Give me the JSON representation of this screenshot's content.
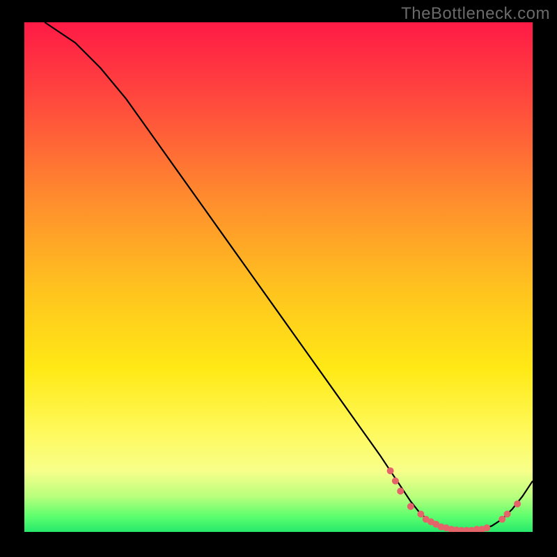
{
  "watermark": "TheBottleneck.com",
  "chart_data": {
    "type": "line",
    "title": "",
    "xlabel": "",
    "ylabel": "",
    "xlim": [
      0,
      100
    ],
    "ylim": [
      0,
      100
    ],
    "grid": false,
    "legend": false,
    "series": [
      {
        "name": "curve",
        "x": [
          4,
          10,
          15,
          20,
          25,
          30,
          35,
          40,
          45,
          50,
          55,
          60,
          65,
          70,
          72,
          74,
          76,
          78,
          80,
          82,
          84,
          86,
          88,
          90,
          92,
          94,
          96,
          98,
          100
        ],
        "y": [
          100,
          96,
          91,
          85,
          78,
          71,
          64,
          57,
          50,
          43,
          36,
          29,
          22,
          15,
          12,
          9,
          6,
          3.5,
          2,
          1,
          0.5,
          0.3,
          0.3,
          0.5,
          1.2,
          2.5,
          4.5,
          7,
          10
        ]
      }
    ],
    "markers": [
      {
        "x": 72,
        "y": 12
      },
      {
        "x": 73,
        "y": 10
      },
      {
        "x": 74,
        "y": 8
      },
      {
        "x": 76,
        "y": 5
      },
      {
        "x": 78,
        "y": 3.5
      },
      {
        "x": 79,
        "y": 2.5
      },
      {
        "x": 80,
        "y": 2
      },
      {
        "x": 81,
        "y": 1.5
      },
      {
        "x": 82,
        "y": 1
      },
      {
        "x": 83,
        "y": 0.8
      },
      {
        "x": 84,
        "y": 0.5
      },
      {
        "x": 85,
        "y": 0.4
      },
      {
        "x": 86,
        "y": 0.3
      },
      {
        "x": 87,
        "y": 0.3
      },
      {
        "x": 88,
        "y": 0.3
      },
      {
        "x": 89,
        "y": 0.5
      },
      {
        "x": 90,
        "y": 0.5
      },
      {
        "x": 91,
        "y": 0.8
      },
      {
        "x": 94,
        "y": 2.5
      },
      {
        "x": 95,
        "y": 3.5
      },
      {
        "x": 97,
        "y": 5.5
      }
    ],
    "gradient_stops": [
      {
        "pos": 0,
        "color": "#ff1a46"
      },
      {
        "pos": 16,
        "color": "#ff4b3d"
      },
      {
        "pos": 34,
        "color": "#ff8a2e"
      },
      {
        "pos": 52,
        "color": "#ffc21f"
      },
      {
        "pos": 68,
        "color": "#ffe915"
      },
      {
        "pos": 80,
        "color": "#fff95a"
      },
      {
        "pos": 88,
        "color": "#f8ff8a"
      },
      {
        "pos": 93,
        "color": "#b9ff7d"
      },
      {
        "pos": 97,
        "color": "#5cff6e"
      },
      {
        "pos": 100,
        "color": "#26e86b"
      }
    ],
    "marker_color": "#e4646a",
    "line_color": "#000000"
  }
}
